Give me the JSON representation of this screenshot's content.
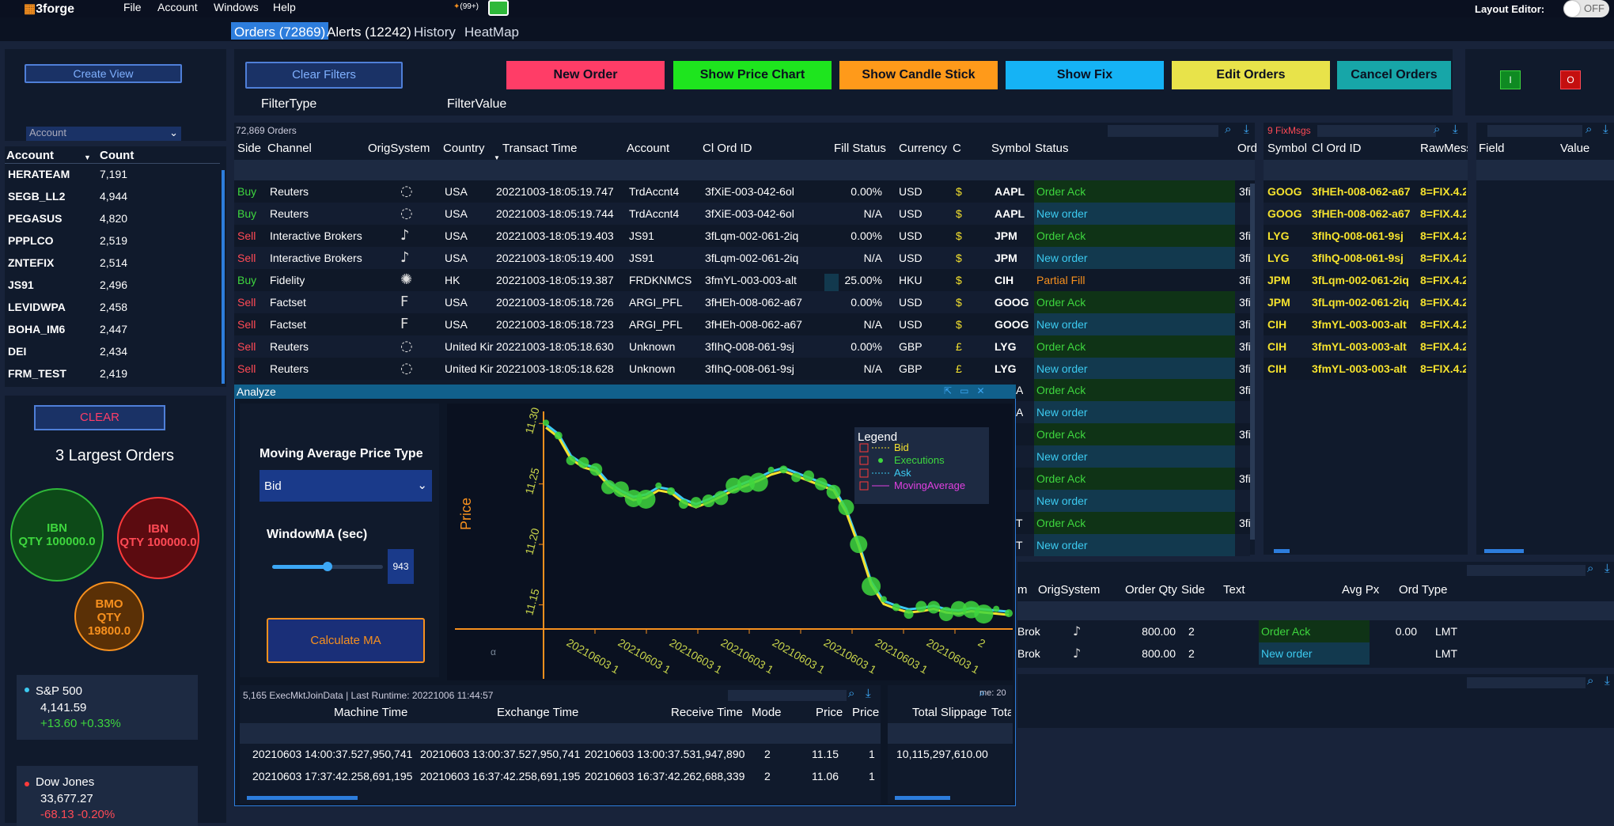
{
  "app": {
    "logo": "3forge",
    "menu": [
      "File",
      "Account",
      "Windows",
      "Help"
    ],
    "notif": "(99+)",
    "layout_editor": "Layout Editor:",
    "toggle": "OFF"
  },
  "tabs": [
    {
      "label": "Orders (72869)"
    },
    {
      "label": "Alerts (12242)"
    },
    {
      "label": "History"
    },
    {
      "label": "HeatMap"
    }
  ],
  "left": {
    "create_view": "Create View",
    "account_select": "Account",
    "acct_header": {
      "account": "Account",
      "count": "Count"
    },
    "accounts": [
      {
        "a": "HERATEAM",
        "c": "7,191"
      },
      {
        "a": "SEGB_LL2",
        "c": "4,944"
      },
      {
        "a": "PEGASUS",
        "c": "4,820"
      },
      {
        "a": "PPPLCO",
        "c": "2,519"
      },
      {
        "a": "ZNTEFIX",
        "c": "2,514"
      },
      {
        "a": "JS91",
        "c": "2,496"
      },
      {
        "a": "LEVIDWPA",
        "c": "2,458"
      },
      {
        "a": "BOHA_IM6",
        "c": "2,447"
      },
      {
        "a": "DEI",
        "c": "2,434"
      },
      {
        "a": "FRM_TEST",
        "c": "2,419"
      }
    ],
    "clear": "CLEAR",
    "largest_title": "3 Largest Orders",
    "bubbles": [
      {
        "sym": "IBN",
        "qty": "QTY 100000.0"
      },
      {
        "sym": "IBN",
        "qty": "QTY 100000.0"
      },
      {
        "sym": "BMO",
        "qty": "QTY",
        "qty2": "19800.0"
      }
    ],
    "indices": [
      {
        "name": "S&P 500",
        "value": "4,141.59",
        "change": "+13.60 +0.33%",
        "color": "#3ccaf0",
        "chg_color": "#3ed63e"
      },
      {
        "name": "Dow Jones",
        "value": "33,677.27",
        "change": "-68.13 -0.20%",
        "color": "#ff3a3a",
        "chg_color": "#ff4a55"
      }
    ]
  },
  "filters": {
    "clear": "Clear Filters",
    "type": "FilterType",
    "value": "FilterValue"
  },
  "actions": [
    {
      "label": "New Order",
      "color": "#ff3d67"
    },
    {
      "label": "Show Price Chart",
      "color": "#1ee51e"
    },
    {
      "label": "Show Candle Stick",
      "color": "#ff9a1a"
    },
    {
      "label": "Show Fix",
      "color": "#15b3f5"
    },
    {
      "label": "Edit Orders",
      "color": "#e8e34a"
    },
    {
      "label": "Cancel Orders",
      "color": "#17a6a8"
    }
  ],
  "io": {
    "i": "I",
    "o": "O"
  },
  "orders": {
    "count": "72,869 Orders",
    "headers": [
      "Side",
      "Channel",
      "OrigSystem",
      "Country",
      "Transact Time",
      "Account",
      "Cl Ord ID",
      "Fill Status",
      "Currency",
      "C",
      "Symbol",
      "Status",
      "Ord"
    ],
    "rows": [
      {
        "side": "Buy",
        "channel": "Reuters",
        "icon": "reuters-icon",
        "country": "USA",
        "time": "20221003-18:05:19.747",
        "account": "TrdAccnt4",
        "clord": "3fXiE-003-042-6ol",
        "fill": "0.00%",
        "ccy": "USD",
        "c": "$",
        "sym": "AAPL",
        "status": "Order Ack",
        "ord": "3fi"
      },
      {
        "side": "Buy",
        "channel": "Reuters",
        "icon": "reuters-icon",
        "country": "USA",
        "time": "20221003-18:05:19.744",
        "account": "TrdAccnt4",
        "clord": "3fXiE-003-042-6ol",
        "fill": "N/A",
        "ccy": "USD",
        "c": "$",
        "sym": "AAPL",
        "status": "New order",
        "ord": ""
      },
      {
        "side": "Sell",
        "channel": "Interactive Brokers",
        "icon": "ib-icon",
        "country": "USA",
        "time": "20221003-18:05:19.403",
        "account": "JS91",
        "clord": "3fLqm-002-061-2iq",
        "fill": "0.00%",
        "ccy": "USD",
        "c": "$",
        "sym": "JPM",
        "status": "Order Ack",
        "ord": "3fi"
      },
      {
        "side": "Sell",
        "channel": "Interactive Brokers",
        "icon": "ib-icon",
        "country": "USA",
        "time": "20221003-18:05:19.400",
        "account": "JS91",
        "clord": "3fLqm-002-061-2iq",
        "fill": "N/A",
        "ccy": "USD",
        "c": "$",
        "sym": "JPM",
        "status": "New order",
        "ord": "3fi"
      },
      {
        "side": "Buy",
        "channel": "Fidelity",
        "icon": "fidelity-icon",
        "country": "HK",
        "time": "20221003-18:05:19.387",
        "account": "FRDKNMCS",
        "clord": "3fmYL-003-003-alt",
        "fill": "25.00%",
        "ccy": "HKU",
        "c": "$",
        "sym": "CIH",
        "status": "Partial Fill",
        "ord": "3fi"
      },
      {
        "side": "Sell",
        "channel": "Factset",
        "icon": "factset-icon",
        "country": "USA",
        "time": "20221003-18:05:18.726",
        "account": "ARGI_PFL",
        "clord": "3fHEh-008-062-a67",
        "fill": "0.00%",
        "ccy": "USD",
        "c": "$",
        "sym": "GOOG",
        "status": "Order Ack",
        "ord": "3fi"
      },
      {
        "side": "Sell",
        "channel": "Factset",
        "icon": "factset-icon",
        "country": "USA",
        "time": "20221003-18:05:18.723",
        "account": "ARGI_PFL",
        "clord": "3fHEh-008-062-a67",
        "fill": "N/A",
        "ccy": "USD",
        "c": "$",
        "sym": "GOOG",
        "status": "New order",
        "ord": "3fi"
      },
      {
        "side": "Sell",
        "channel": "Reuters",
        "icon": "reuters-icon",
        "country": "United Kir",
        "time": "20221003-18:05:18.630",
        "account": "Unknown",
        "clord": "3fIhQ-008-061-9sj",
        "fill": "0.00%",
        "ccy": "GBP",
        "c": "£",
        "sym": "LYG",
        "status": "Order Ack",
        "ord": "3fi"
      },
      {
        "side": "Sell",
        "channel": "Reuters",
        "icon": "reuters-icon",
        "country": "United Kir",
        "time": "20221003-18:05:18.628",
        "account": "Unknown",
        "clord": "3fIhQ-008-061-9sj",
        "fill": "N/A",
        "ccy": "GBP",
        "c": "£",
        "sym": "LYG",
        "status": "New order",
        "ord": "3fi"
      }
    ],
    "hidden_rows": [
      {
        "pre": "A",
        "status": "Order Ack",
        "ord": "3fi"
      },
      {
        "pre": "A",
        "status": "New order",
        "ord": ""
      },
      {
        "pre": "",
        "status": "Order Ack",
        "ord": "3fi"
      },
      {
        "pre": "",
        "status": "New order",
        "ord": ""
      },
      {
        "pre": "",
        "status": "Order Ack",
        "ord": "3fi"
      },
      {
        "pre": "",
        "status": "New order",
        "ord": ""
      },
      {
        "pre": "T",
        "status": "Order Ack",
        "ord": "3fi"
      },
      {
        "pre": "T",
        "status": "New order",
        "ord": ""
      }
    ]
  },
  "fix": {
    "count": "9 FixMsgs",
    "headers": [
      "Symbol",
      "Cl Ord ID",
      "RawMess"
    ],
    "rows": [
      {
        "s": "GOOG",
        "id": "3fHEh-008-062-a67",
        "raw": "8=FIX.4.2"
      },
      {
        "s": "GOOG",
        "id": "3fHEh-008-062-a67",
        "raw": "8=FIX.4.2"
      },
      {
        "s": "LYG",
        "id": "3fIhQ-008-061-9sj",
        "raw": "8=FIX.4.2"
      },
      {
        "s": "LYG",
        "id": "3fIhQ-008-061-9sj",
        "raw": "8=FIX.4.2"
      },
      {
        "s": "JPM",
        "id": "3fLqm-002-061-2iq",
        "raw": "8=FIX.4.2"
      },
      {
        "s": "JPM",
        "id": "3fLqm-002-061-2iq",
        "raw": "8=FIX.4.2"
      },
      {
        "s": "CIH",
        "id": "3fmYL-003-003-alt",
        "raw": "8=FIX.4.2"
      },
      {
        "s": "CIH",
        "id": "3fmYL-003-003-alt",
        "raw": "8=FIX.4.2"
      },
      {
        "s": "CIH",
        "id": "3fmYL-003-003-alt",
        "raw": "8=FIX.4.2"
      }
    ]
  },
  "fv": {
    "headers": [
      "Field",
      "Value"
    ]
  },
  "analyze": {
    "title": "Analyze",
    "ma_label": "Moving Average Price Type",
    "ma_value": "Bid",
    "window_label": "WindowMA (sec)",
    "window_value": "943",
    "slider": 0.5,
    "calc": "Calculate MA",
    "legend_title": "Legend",
    "legend": [
      {
        "name": "Bid",
        "color": "#f5e22e"
      },
      {
        "name": "Executions",
        "color": "#3ed63e"
      },
      {
        "name": "Ask",
        "color": "#3ccaf0"
      },
      {
        "name": "MovingAverage",
        "color": "#e040e0"
      }
    ],
    "ylabel": "Price",
    "yticks": [
      "11.30",
      "11.25",
      "11.20",
      "11.15"
    ],
    "xticks": [
      "20210603 1",
      "20210603 1",
      "20210603 1",
      "20210603 1",
      "20210603 1",
      "20210603 1",
      "20210603 1",
      "20210603 1",
      "2"
    ],
    "exec_title": "5,165 ExecMktJoinData | Last Runtime: 20221006 11:44:57",
    "exec_headers": [
      "Machine Time",
      "Exchange Time",
      "Receive Time",
      "Mode",
      "Price",
      "Price"
    ],
    "exec_rows": [
      [
        "20210603 14:00:37.527,950,741",
        "20210603 13:00:37.527,950,741",
        "20210603 13:00:37.531,947,890",
        "2",
        "11.15",
        "1"
      ],
      [
        "20210603 17:37:42.258,691,195",
        "20210603 16:37:42.258,691,195",
        "20210603 16:37:42.262,688,339",
        "2",
        "11.06",
        "1"
      ]
    ],
    "slip_headers": [
      "Total Slippage",
      "Tota"
    ],
    "slip_rows": [
      "10,115,297,610.00",
      ""
    ],
    "slip_overlay": "me: 20"
  },
  "exec_panel": {
    "headers": [
      "m",
      "OrigSystem",
      "Order Qty",
      "Side",
      "Text",
      "Avg Px",
      "Ord Type"
    ],
    "rows": [
      {
        "m": "Brok",
        "qty": "800.00",
        "side": "2",
        "text": "Order Ack",
        "px": "0.00",
        "type": "LMT"
      },
      {
        "m": "Brok",
        "qty": "800.00",
        "side": "2",
        "text": "New order",
        "px": "",
        "type": "LMT"
      }
    ]
  },
  "chart_data": {
    "type": "scatter",
    "ylabel": "Price",
    "ylim": [
      11.13,
      11.31
    ],
    "series": [
      {
        "name": "Bid"
      },
      {
        "name": "Executions"
      },
      {
        "name": "Ask"
      },
      {
        "name": "MovingAverage"
      }
    ]
  }
}
